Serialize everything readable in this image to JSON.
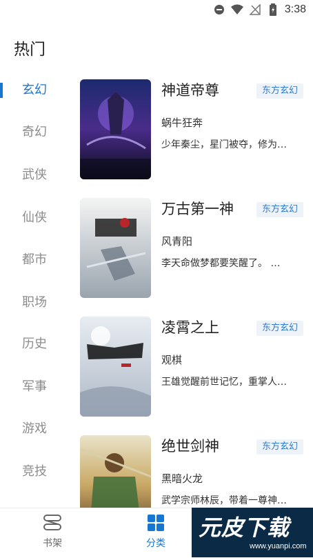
{
  "status_bar": {
    "time": "3:38"
  },
  "page_title": "热门",
  "categories": [
    "玄幻",
    "奇幻",
    "武侠",
    "仙侠",
    "都市",
    "职场",
    "历史",
    "军事",
    "游戏",
    "竞技"
  ],
  "active_category": "玄幻",
  "books": [
    {
      "title": "神道帝尊",
      "tag": "东方玄幻",
      "author": "蜗牛狂奔",
      "desc": "少年秦尘，星门被夺，修为…"
    },
    {
      "title": "万古第一神",
      "tag": "东方玄幻",
      "author": "风青阳",
      "desc": "李天命做梦都要笑醒了。 …"
    },
    {
      "title": "凌霄之上",
      "tag": "东方玄幻",
      "author": "观棋",
      "desc": "王雄觉醒前世记忆，重掌人…"
    },
    {
      "title": "绝世剑神",
      "tag": "东方玄幻",
      "author": "黑暗火龙",
      "desc": "武学宗师林辰，带着一尊神…"
    }
  ],
  "bottom_nav": {
    "items": [
      {
        "label": "书架",
        "icon": "bookshelf-icon"
      },
      {
        "label": "分类",
        "icon": "category-grid-icon"
      }
    ]
  },
  "watermark": {
    "text": "元皮下载",
    "url": "www.yuanpi.com"
  },
  "colors": {
    "accent": "#1677d2",
    "tag_bg": "#eef3fa",
    "inactive": "#8c8c8c"
  }
}
